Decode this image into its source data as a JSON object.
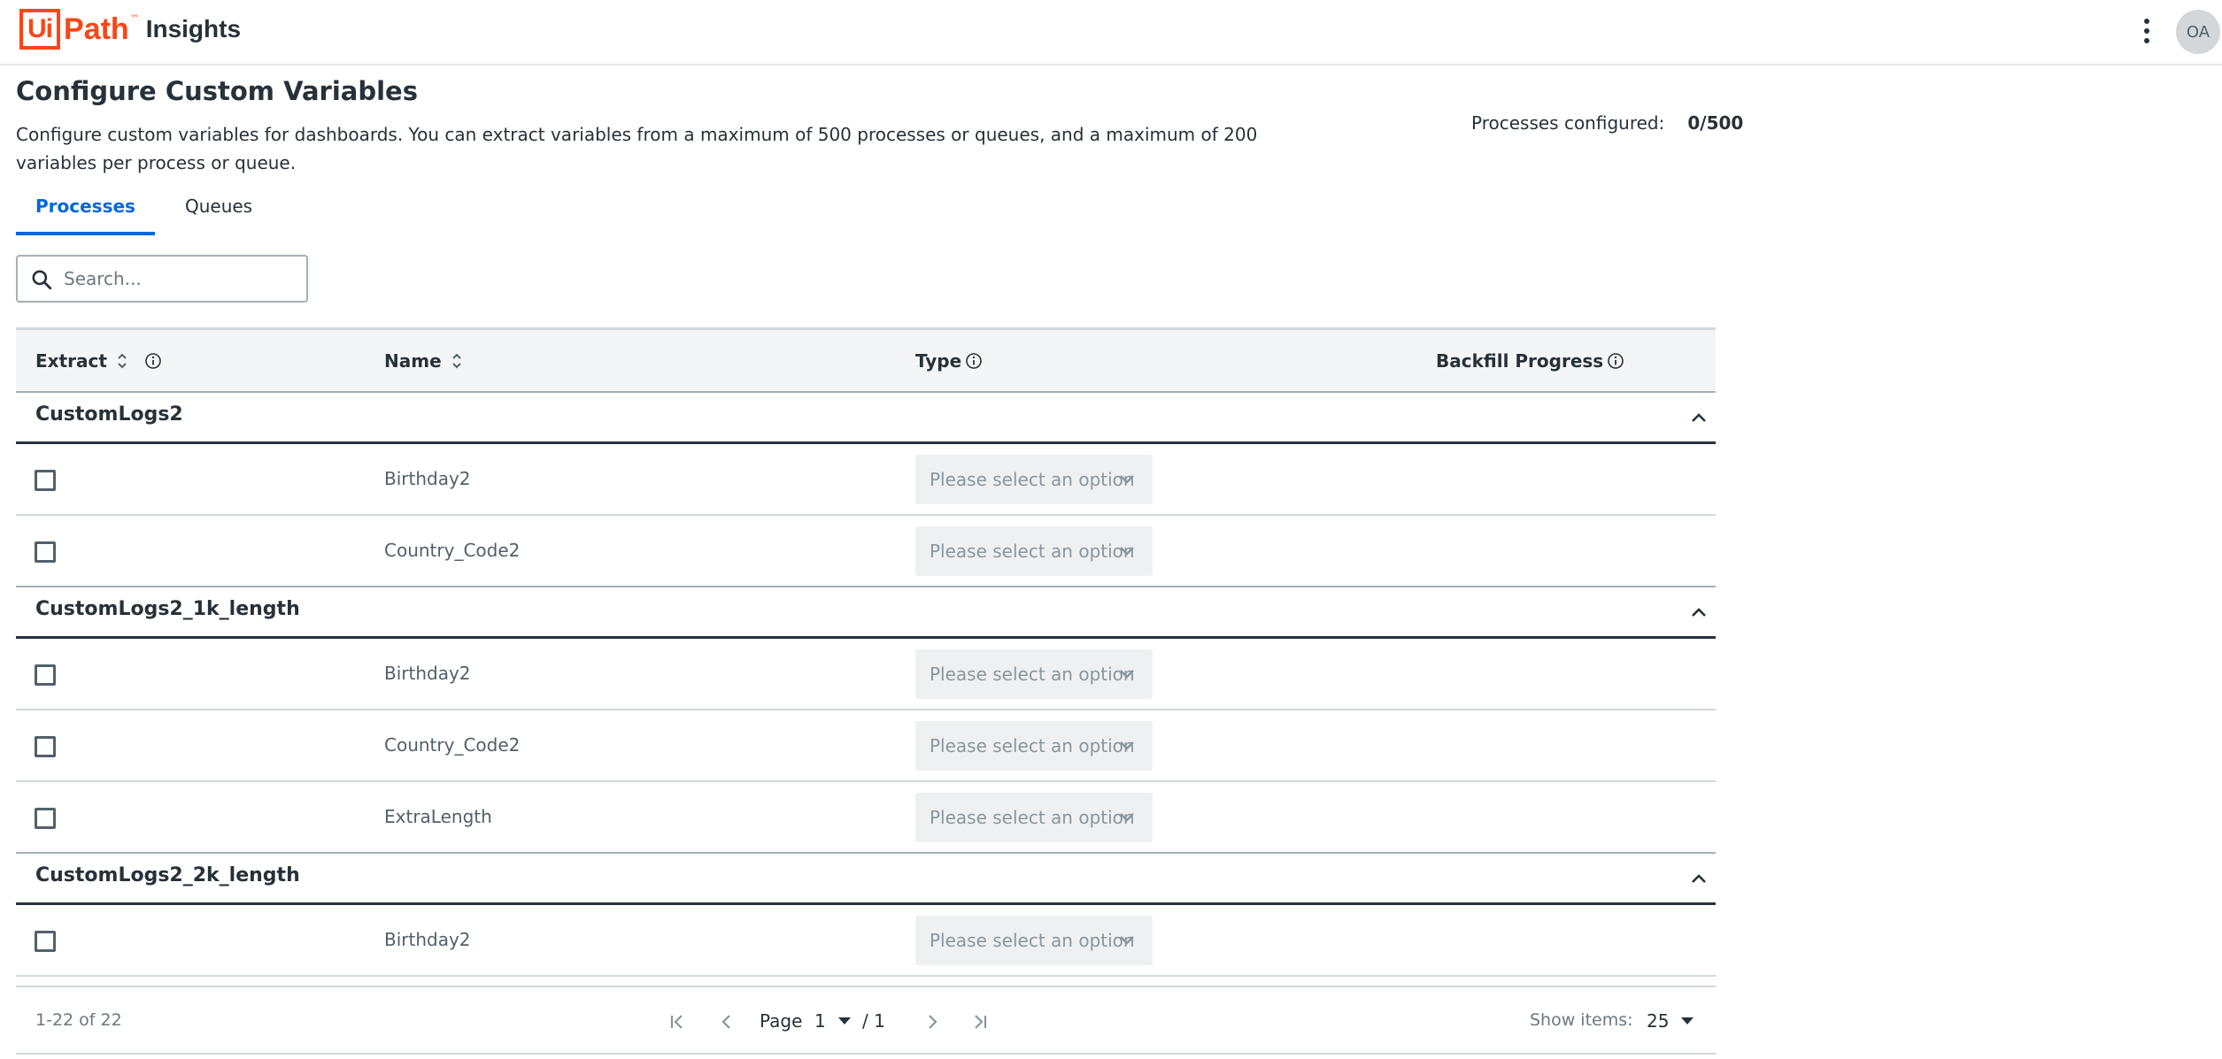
{
  "header": {
    "logo_ui": "Ui",
    "logo_path": "Path",
    "logo_tm": "™",
    "product": "Insights",
    "avatar_initials": "OA"
  },
  "page": {
    "title": "Configure Custom Variables",
    "description": "Configure custom variables for dashboards. You can extract variables from a maximum of 500 processes or queues, and a maximum of 200 variables per process or queue.",
    "processes_configured_label": "Processes configured:",
    "processes_configured_value": "0/500"
  },
  "tabs": [
    {
      "label": "Processes",
      "active": true
    },
    {
      "label": "Queues",
      "active": false
    }
  ],
  "search": {
    "placeholder": "Search..."
  },
  "table": {
    "columns": {
      "extract": "Extract",
      "name": "Name",
      "type": "Type",
      "backfill": "Backfill Progress"
    },
    "groups": [
      {
        "name": "CustomLogs2",
        "rows": [
          {
            "name": "Birthday2",
            "type": "Please select an option"
          },
          {
            "name": "Country_Code2",
            "type": "Please select an option"
          }
        ]
      },
      {
        "name": "CustomLogs2_1k_length",
        "rows": [
          {
            "name": "Birthday2",
            "type": "Please select an option"
          },
          {
            "name": "Country_Code2",
            "type": "Please select an option"
          },
          {
            "name": "ExtraLength",
            "type": "Please select an option"
          }
        ]
      },
      {
        "name": "CustomLogs2_2k_length",
        "rows": [
          {
            "name": "Birthday2",
            "type": "Please select an option"
          }
        ]
      }
    ]
  },
  "pagination": {
    "range": "1-22 of 22",
    "page_label": "Page",
    "page_value": "1",
    "page_total": "/ 1",
    "show_items_label": "Show items:",
    "show_items_value": "25"
  },
  "colors": {
    "brand": "#fa4616",
    "accent": "#0067df",
    "text": "#273139"
  }
}
